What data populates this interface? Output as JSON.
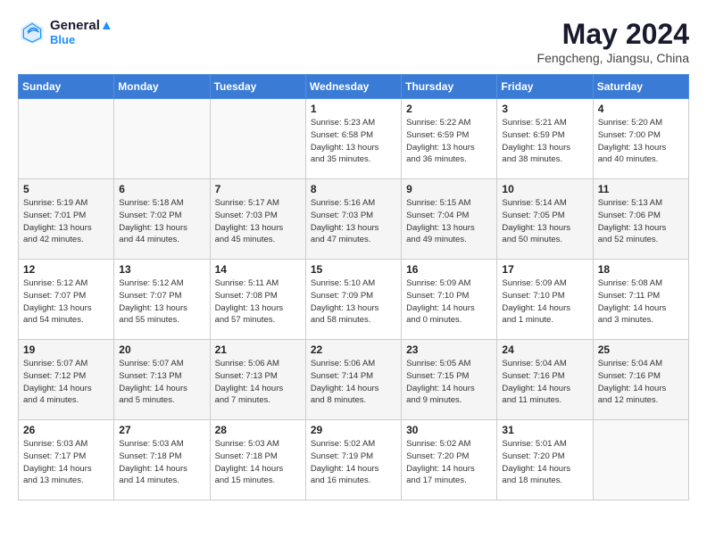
{
  "header": {
    "logo_line1": "General",
    "logo_line2": "Blue",
    "month_year": "May 2024",
    "location": "Fengcheng, Jiangsu, China"
  },
  "days_of_week": [
    "Sunday",
    "Monday",
    "Tuesday",
    "Wednesday",
    "Thursday",
    "Friday",
    "Saturday"
  ],
  "weeks": [
    [
      {
        "num": "",
        "info": ""
      },
      {
        "num": "",
        "info": ""
      },
      {
        "num": "",
        "info": ""
      },
      {
        "num": "1",
        "info": "Sunrise: 5:23 AM\nSunset: 6:58 PM\nDaylight: 13 hours\nand 35 minutes."
      },
      {
        "num": "2",
        "info": "Sunrise: 5:22 AM\nSunset: 6:59 PM\nDaylight: 13 hours\nand 36 minutes."
      },
      {
        "num": "3",
        "info": "Sunrise: 5:21 AM\nSunset: 6:59 PM\nDaylight: 13 hours\nand 38 minutes."
      },
      {
        "num": "4",
        "info": "Sunrise: 5:20 AM\nSunset: 7:00 PM\nDaylight: 13 hours\nand 40 minutes."
      }
    ],
    [
      {
        "num": "5",
        "info": "Sunrise: 5:19 AM\nSunset: 7:01 PM\nDaylight: 13 hours\nand 42 minutes."
      },
      {
        "num": "6",
        "info": "Sunrise: 5:18 AM\nSunset: 7:02 PM\nDaylight: 13 hours\nand 44 minutes."
      },
      {
        "num": "7",
        "info": "Sunrise: 5:17 AM\nSunset: 7:03 PM\nDaylight: 13 hours\nand 45 minutes."
      },
      {
        "num": "8",
        "info": "Sunrise: 5:16 AM\nSunset: 7:03 PM\nDaylight: 13 hours\nand 47 minutes."
      },
      {
        "num": "9",
        "info": "Sunrise: 5:15 AM\nSunset: 7:04 PM\nDaylight: 13 hours\nand 49 minutes."
      },
      {
        "num": "10",
        "info": "Sunrise: 5:14 AM\nSunset: 7:05 PM\nDaylight: 13 hours\nand 50 minutes."
      },
      {
        "num": "11",
        "info": "Sunrise: 5:13 AM\nSunset: 7:06 PM\nDaylight: 13 hours\nand 52 minutes."
      }
    ],
    [
      {
        "num": "12",
        "info": "Sunrise: 5:12 AM\nSunset: 7:07 PM\nDaylight: 13 hours\nand 54 minutes."
      },
      {
        "num": "13",
        "info": "Sunrise: 5:12 AM\nSunset: 7:07 PM\nDaylight: 13 hours\nand 55 minutes."
      },
      {
        "num": "14",
        "info": "Sunrise: 5:11 AM\nSunset: 7:08 PM\nDaylight: 13 hours\nand 57 minutes."
      },
      {
        "num": "15",
        "info": "Sunrise: 5:10 AM\nSunset: 7:09 PM\nDaylight: 13 hours\nand 58 minutes."
      },
      {
        "num": "16",
        "info": "Sunrise: 5:09 AM\nSunset: 7:10 PM\nDaylight: 14 hours\nand 0 minutes."
      },
      {
        "num": "17",
        "info": "Sunrise: 5:09 AM\nSunset: 7:10 PM\nDaylight: 14 hours\nand 1 minute."
      },
      {
        "num": "18",
        "info": "Sunrise: 5:08 AM\nSunset: 7:11 PM\nDaylight: 14 hours\nand 3 minutes."
      }
    ],
    [
      {
        "num": "19",
        "info": "Sunrise: 5:07 AM\nSunset: 7:12 PM\nDaylight: 14 hours\nand 4 minutes."
      },
      {
        "num": "20",
        "info": "Sunrise: 5:07 AM\nSunset: 7:13 PM\nDaylight: 14 hours\nand 5 minutes."
      },
      {
        "num": "21",
        "info": "Sunrise: 5:06 AM\nSunset: 7:13 PM\nDaylight: 14 hours\nand 7 minutes."
      },
      {
        "num": "22",
        "info": "Sunrise: 5:06 AM\nSunset: 7:14 PM\nDaylight: 14 hours\nand 8 minutes."
      },
      {
        "num": "23",
        "info": "Sunrise: 5:05 AM\nSunset: 7:15 PM\nDaylight: 14 hours\nand 9 minutes."
      },
      {
        "num": "24",
        "info": "Sunrise: 5:04 AM\nSunset: 7:16 PM\nDaylight: 14 hours\nand 11 minutes."
      },
      {
        "num": "25",
        "info": "Sunrise: 5:04 AM\nSunset: 7:16 PM\nDaylight: 14 hours\nand 12 minutes."
      }
    ],
    [
      {
        "num": "26",
        "info": "Sunrise: 5:03 AM\nSunset: 7:17 PM\nDaylight: 14 hours\nand 13 minutes."
      },
      {
        "num": "27",
        "info": "Sunrise: 5:03 AM\nSunset: 7:18 PM\nDaylight: 14 hours\nand 14 minutes."
      },
      {
        "num": "28",
        "info": "Sunrise: 5:03 AM\nSunset: 7:18 PM\nDaylight: 14 hours\nand 15 minutes."
      },
      {
        "num": "29",
        "info": "Sunrise: 5:02 AM\nSunset: 7:19 PM\nDaylight: 14 hours\nand 16 minutes."
      },
      {
        "num": "30",
        "info": "Sunrise: 5:02 AM\nSunset: 7:20 PM\nDaylight: 14 hours\nand 17 minutes."
      },
      {
        "num": "31",
        "info": "Sunrise: 5:01 AM\nSunset: 7:20 PM\nDaylight: 14 hours\nand 18 minutes."
      },
      {
        "num": "",
        "info": ""
      }
    ]
  ]
}
